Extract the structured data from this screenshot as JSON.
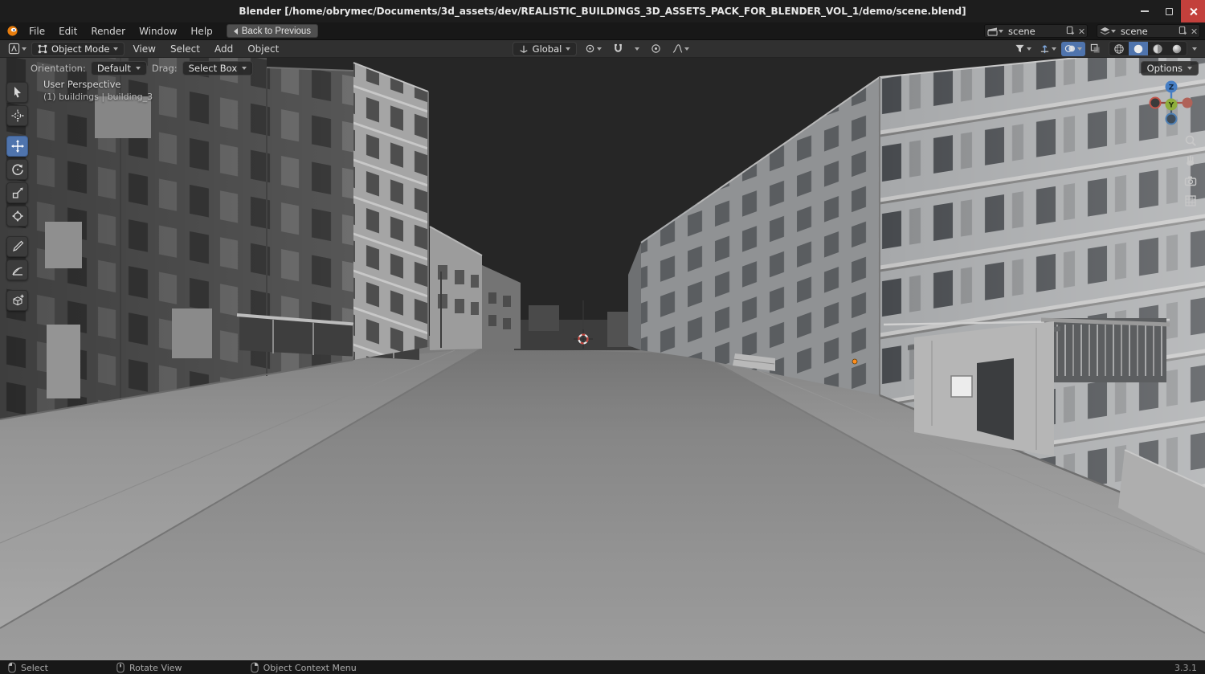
{
  "window": {
    "title": "Blender [/home/obrymec/Documents/3d_assets/dev/REALISTIC_BUILDINGS_3D_ASSETS_PACK_FOR_BLENDER_VOL_1/demo/scene.blend]"
  },
  "menu_bar": {
    "items": [
      "File",
      "Edit",
      "Render",
      "Window",
      "Help"
    ],
    "back_button": "Back to Previous",
    "scene_selector": {
      "value": "scene"
    },
    "view_layer_selector": {
      "value": "scene"
    }
  },
  "tool_header": {
    "mode": "Object Mode",
    "menus": [
      "View",
      "Select",
      "Add",
      "Object"
    ],
    "orientation": "Global",
    "shading_modes": [
      "wireframe",
      "solid",
      "material-preview",
      "rendered"
    ],
    "active_shading": "solid"
  },
  "viewport": {
    "options_button": "Options",
    "orientation_label": "Orientation:",
    "orientation_value": "Default",
    "drag_label": "Drag:",
    "drag_value": "Select Box",
    "view_name": "User Perspective",
    "selection_info": "(1) buildings | building_3",
    "gizmo_axes": {
      "x": "X",
      "y": "Y",
      "z": "Z"
    }
  },
  "toolbar": {
    "tools": [
      "select-box",
      "cursor",
      "move",
      "rotate",
      "scale",
      "transform",
      "annotate",
      "measure",
      "add-cube"
    ],
    "active_tool": "move"
  },
  "status_bar": {
    "left_mouse": "Select",
    "middle_mouse": "Rotate View",
    "right_mouse": "Object Context Menu",
    "version": "3.3.1"
  },
  "colors": {
    "accent_blue": "#4f74ad",
    "axis_x_red": "#c4554a",
    "axis_y_green": "#8fae3c",
    "axis_z_blue": "#467ec4",
    "origin_orange": "#ff8e1d",
    "close_button_red": "#c3403c",
    "blender_orange": "#e87d0d"
  }
}
